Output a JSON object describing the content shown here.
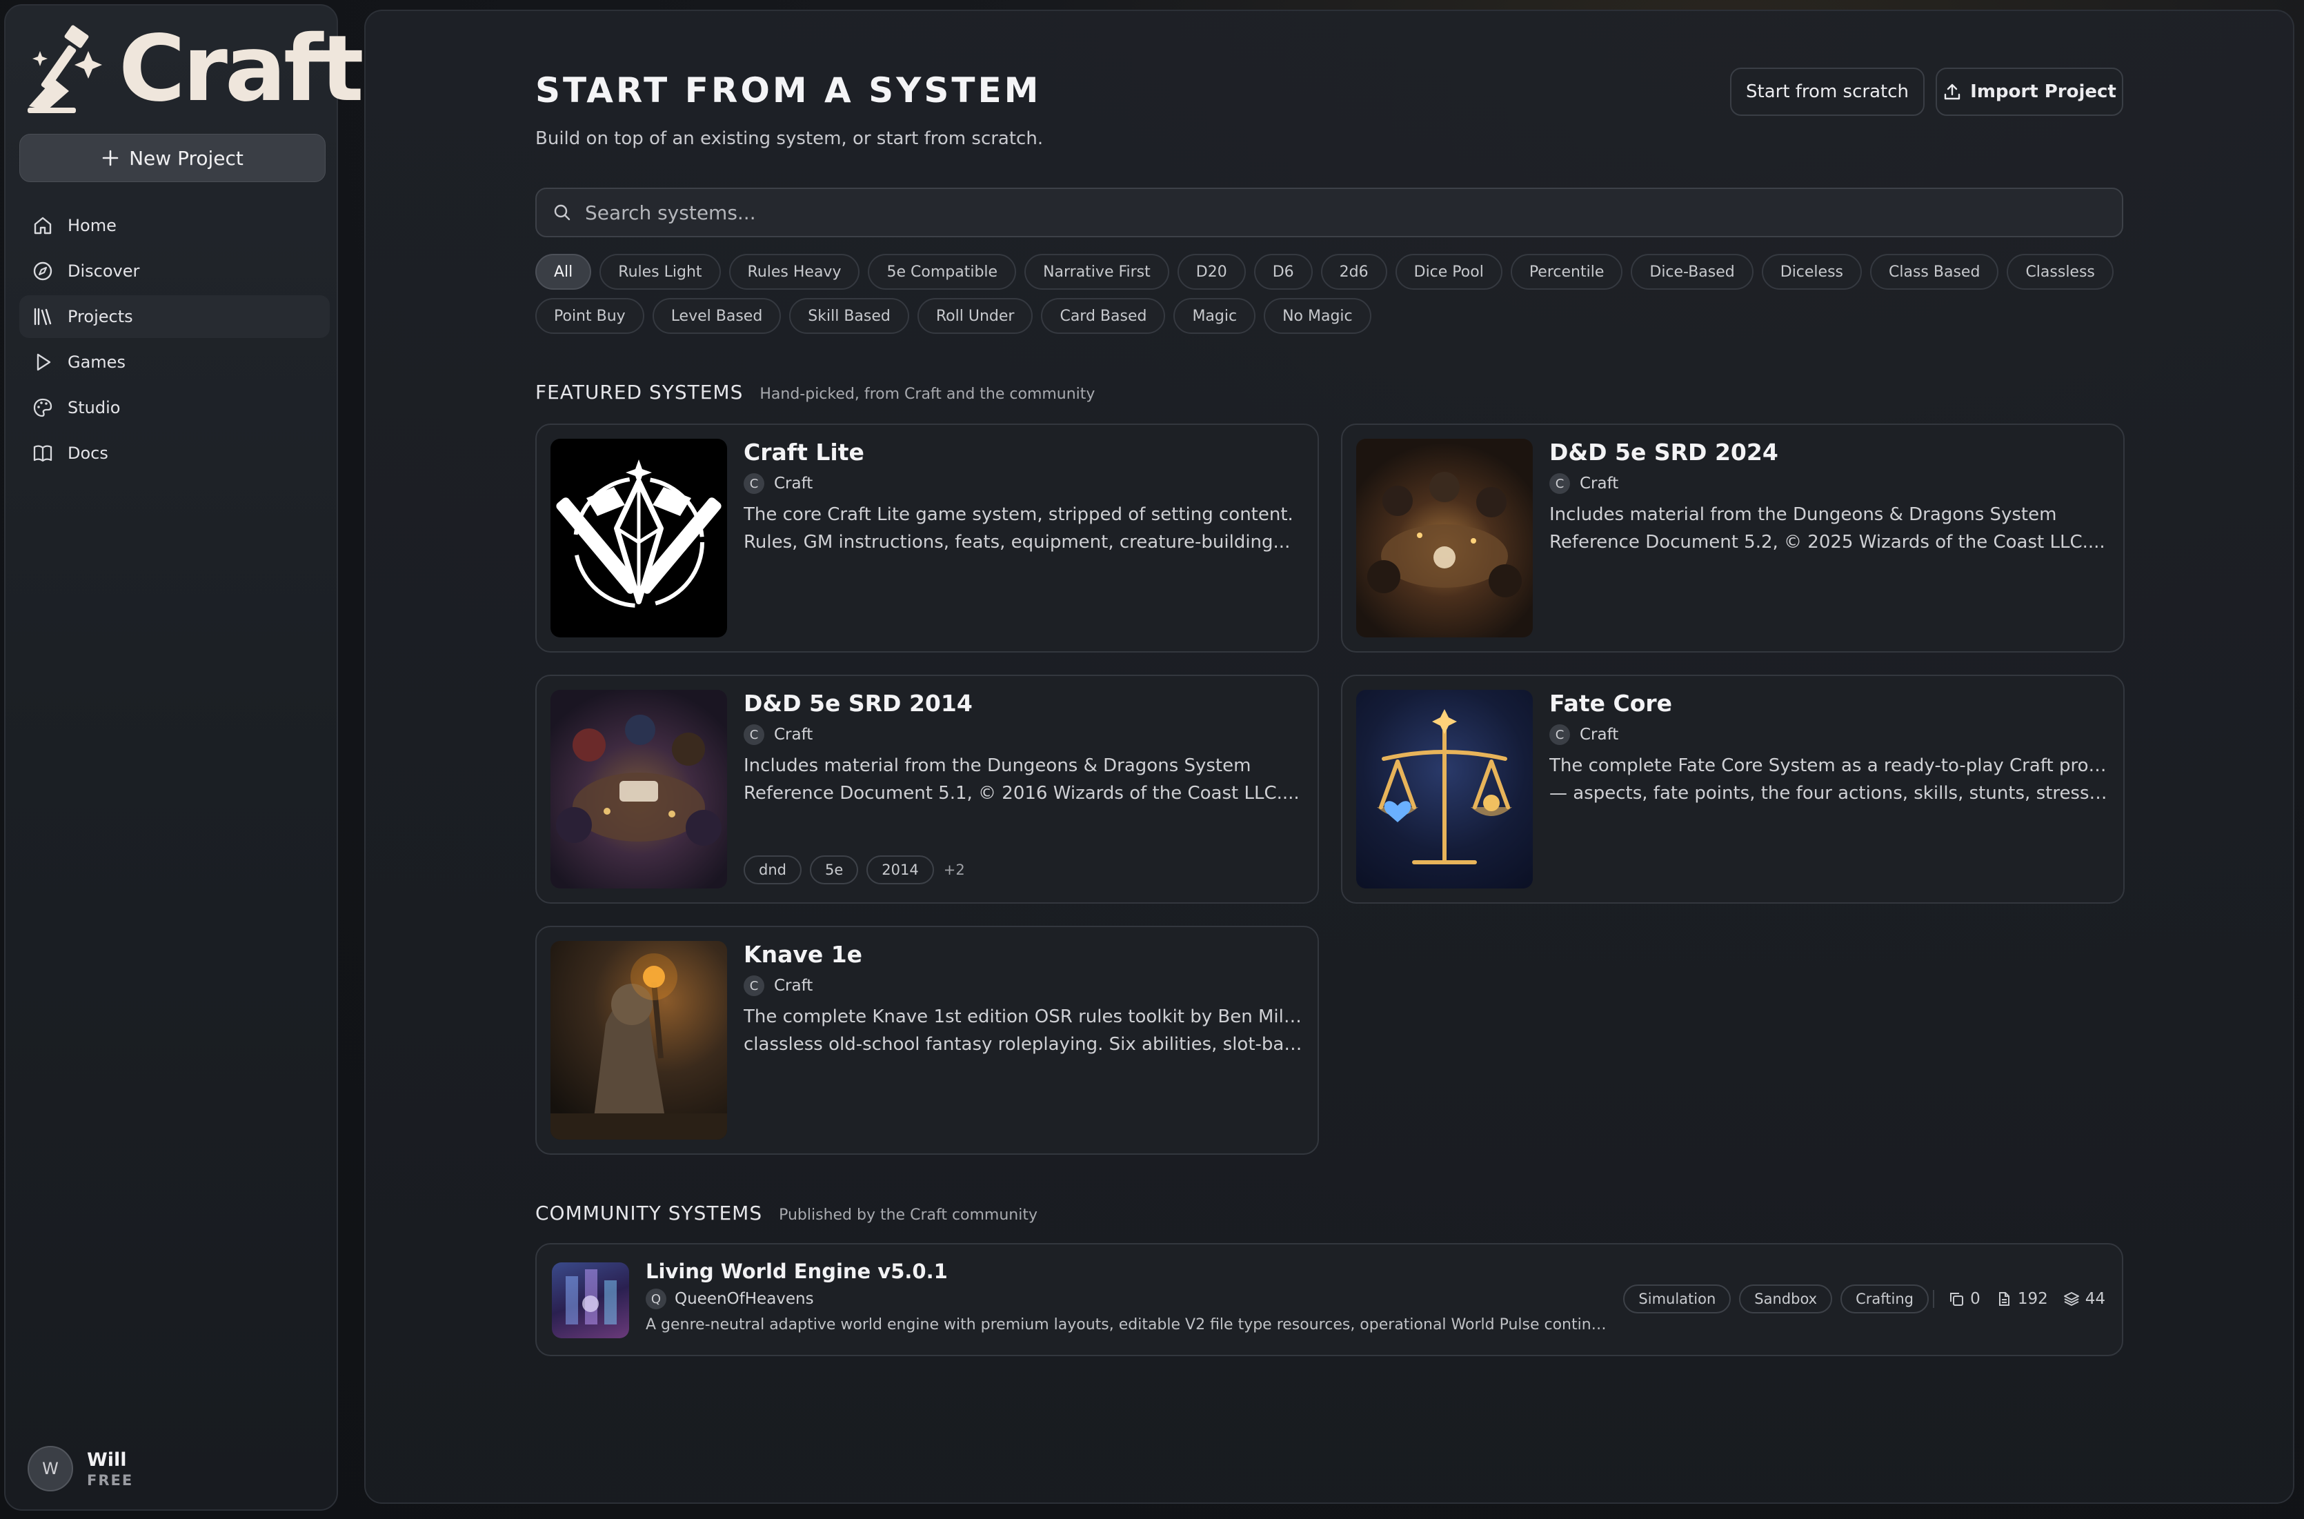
{
  "app": {
    "logo_text": "Craft"
  },
  "sidebar": {
    "new_project_label": "New Project",
    "items": [
      {
        "label": "Home",
        "icon": "home-icon"
      },
      {
        "label": "Discover",
        "icon": "compass-icon"
      },
      {
        "label": "Projects",
        "icon": "library-icon",
        "active": true
      },
      {
        "label": "Games",
        "icon": "play-icon"
      },
      {
        "label": "Studio",
        "icon": "palette-icon"
      },
      {
        "label": "Docs",
        "icon": "book-icon"
      }
    ],
    "user": {
      "initial": "W",
      "name": "Will",
      "plan": "FREE"
    }
  },
  "header": {
    "title": "START FROM A SYSTEM",
    "subtitle": "Build on top of an existing system, or start from scratch.",
    "start_scratch_label": "Start from scratch",
    "import_label": "Import Project"
  },
  "search": {
    "placeholder": "Search systems..."
  },
  "filters": [
    "All",
    "Rules Light",
    "Rules Heavy",
    "5e Compatible",
    "Narrative First",
    "D20",
    "D6",
    "2d6",
    "Dice Pool",
    "Percentile",
    "Dice-Based",
    "Diceless",
    "Class Based",
    "Classless",
    "Point Buy",
    "Level Based",
    "Skill Based",
    "Roll Under",
    "Card Based",
    "Magic",
    "No Magic"
  ],
  "active_filter": "All",
  "featured": {
    "title": "FEATURED SYSTEMS",
    "subtitle": "Hand-picked, from Craft and the community",
    "cards": [
      {
        "title": "Craft Lite",
        "author": "Craft",
        "author_initial": "C",
        "desc": [
          "The core Craft Lite game system, stripped of setting content.",
          "Rules, GM instructions, feats, equipment, creature-building..."
        ],
        "tags": [],
        "more": ""
      },
      {
        "title": "D&D 5e SRD 2024",
        "author": "Craft",
        "author_initial": "C",
        "desc": [
          "Includes material from the Dungeons & Dragons System",
          "Reference Document 5.2, © 2025 Wizards of the Coast LLC...."
        ],
        "tags": [],
        "more": ""
      },
      {
        "title": "D&D 5e SRD 2014",
        "author": "Craft",
        "author_initial": "C",
        "desc": [
          "Includes material from the Dungeons & Dragons System",
          "Reference Document 5.1, © 2016 Wizards of the Coast LLC...."
        ],
        "tags": [
          "dnd",
          "5e",
          "2014"
        ],
        "more": "+2"
      },
      {
        "title": "Fate Core",
        "author": "Craft",
        "author_initial": "C",
        "desc": [
          "The complete Fate Core System as a ready-to-play Craft project",
          "— aspects, fate points, the four actions, skills, stunts, stress and..."
        ],
        "tags": [],
        "more": ""
      },
      {
        "title": "Knave 1e",
        "author": "Craft",
        "author_initial": "C",
        "desc": [
          "The complete Knave 1st edition OSR rules toolkit by Ben Milton —",
          "classless old-school fantasy roleplaying. Six abilities, slot-based..."
        ],
        "tags": [],
        "more": ""
      }
    ]
  },
  "community": {
    "title": "COMMUNITY SYSTEMS",
    "subtitle": "Published by the Craft community",
    "item": {
      "title": "Living World Engine v5.0.1",
      "author": "QueenOfHeavens",
      "author_initial": "Q",
      "desc": "A genre-neutral adaptive world engine with premium layouts, editable V2 file type resources, operational World Pulse continuity, c...",
      "tags": [
        "Simulation",
        "Sandbox",
        "Crafting"
      ],
      "stats": {
        "copies": "0",
        "files": "192",
        "layers": "44"
      }
    }
  }
}
